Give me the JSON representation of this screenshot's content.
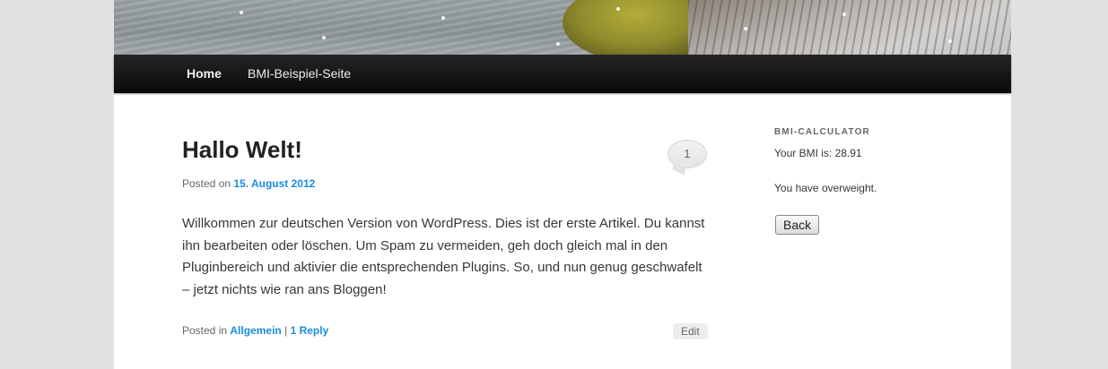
{
  "nav": {
    "items": [
      {
        "label": "Home"
      },
      {
        "label": "BMI-Beispiel-Seite"
      }
    ]
  },
  "post": {
    "title": "Hallo Welt!",
    "comment_count": "1",
    "posted_on_label": "Posted on",
    "date": "15. August 2012",
    "content": "Willkommen zur deutschen Version von WordPress. Dies ist der erste Artikel. Du kannst ihn bearbeiten oder löschen. Um Spam zu vermeiden, geh doch gleich mal in den Pluginbereich und aktivier die entsprechenden Plugins. So, und nun genug geschwafelt – jetzt nichts wie ran ans Bloggen!",
    "posted_in_label": "Posted in",
    "category": "Allgemein",
    "separator": "|",
    "reply_count": "1",
    "reply_label": "Reply",
    "edit_label": "Edit"
  },
  "sidebar": {
    "widget_title": "BMI-CALCULATOR",
    "result": "Your BMI is: 28.91",
    "verdict": "You have overweight.",
    "back_label": "Back"
  }
}
